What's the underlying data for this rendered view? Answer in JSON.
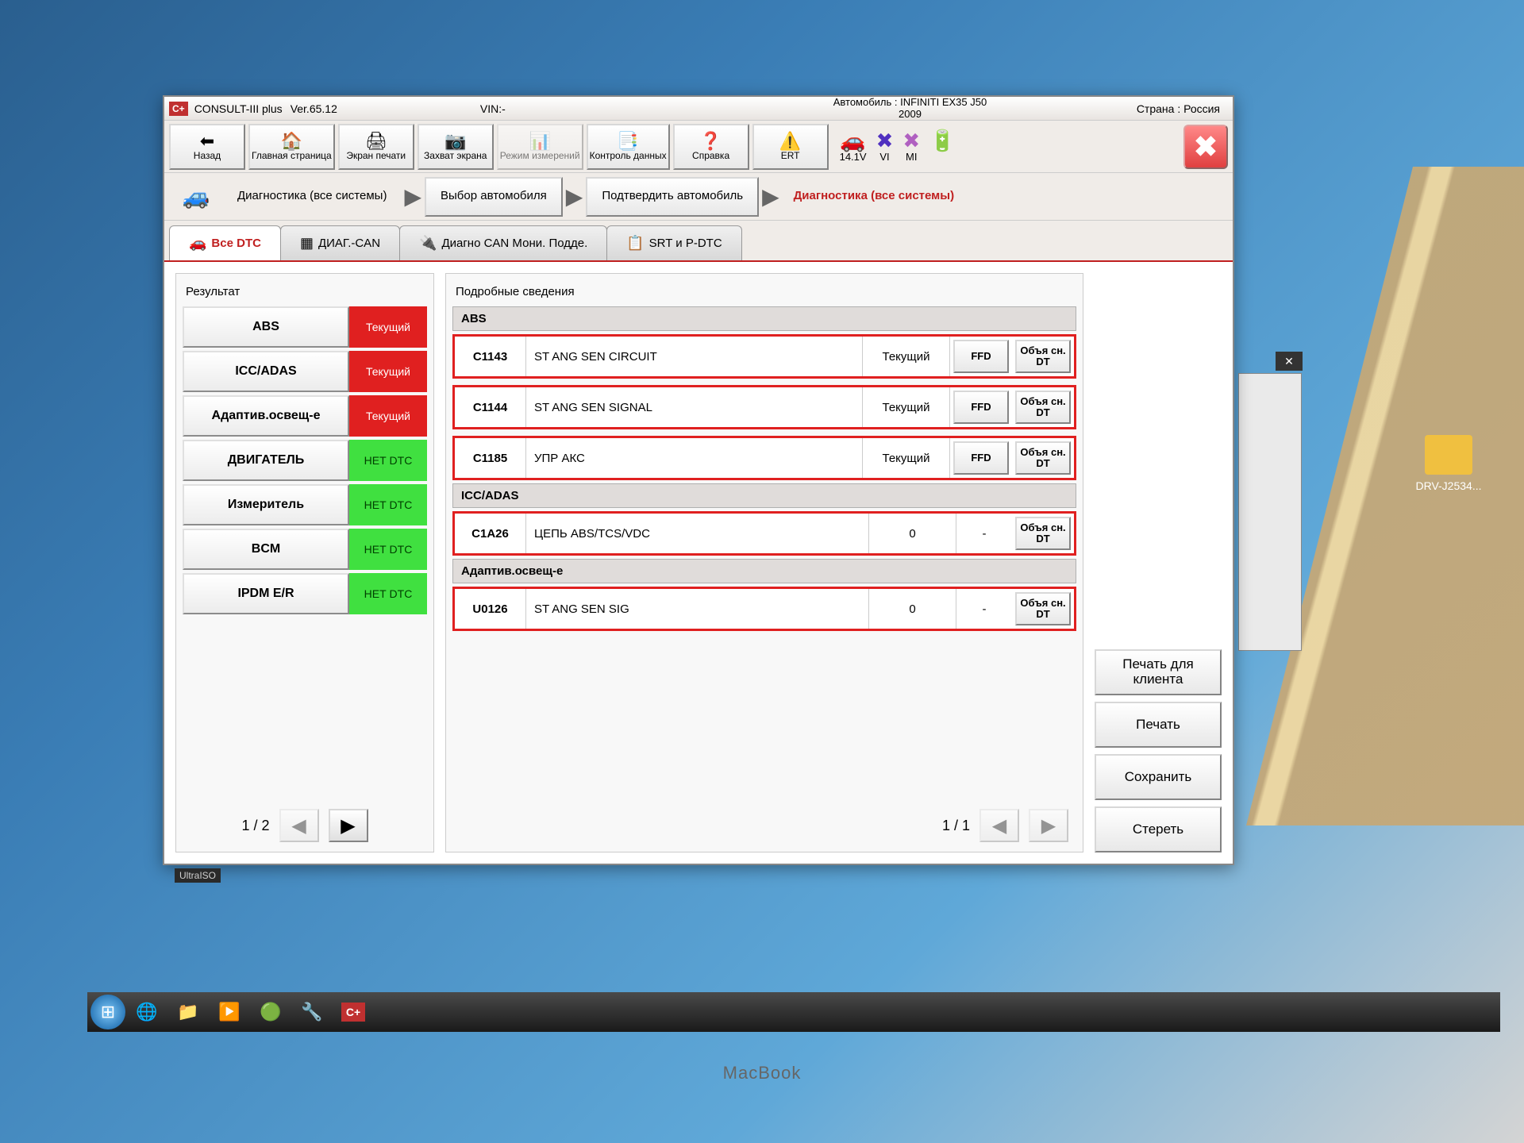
{
  "header": {
    "app_badge": "C+",
    "app_name": "CONSULT-III plus",
    "version_label": "Ver.65.12",
    "vin_label": "VIN:-",
    "vehicle_label": "Автомобиль : INFINITI EX35 J50",
    "vehicle_year": "2009",
    "country_label": "Страна : Россия"
  },
  "toolbar": {
    "back": "Назад",
    "home": "Главная страница",
    "print_screen": "Экран печати",
    "capture": "Захват экрана",
    "mode": "Режим измерений",
    "rec_data": "Контроль данных",
    "help": "Справка",
    "ert": "ERT"
  },
  "status": {
    "voltage": "14.1V",
    "vi": "VI",
    "mi": "MI"
  },
  "breadcrumb": {
    "step1": "Диагностика (все системы)",
    "step2": "Выбор автомобиля",
    "step3": "Подтвердить автомобиль",
    "step4": "Диагностика (все системы)"
  },
  "tabs": {
    "all_dtc": "Все DTC",
    "diag_can": "ДИАГ.-CAN",
    "diag_can_mon": "Диагно CAN Мони. Подде.",
    "srt_pdtc": "SRT и P-DTC"
  },
  "left_panel": {
    "title": "Результат",
    "items": [
      {
        "name": "ABS",
        "status": "Текущий",
        "cls": "st-current"
      },
      {
        "name": "ICC/ADAS",
        "status": "Текущий",
        "cls": "st-current"
      },
      {
        "name": "Адаптив.освещ-е",
        "status": "Текущий",
        "cls": "st-current"
      },
      {
        "name": "ДВИГАТЕЛЬ",
        "status": "НЕТ DTC",
        "cls": "st-none"
      },
      {
        "name": "Измеритель",
        "status": "НЕТ DTC",
        "cls": "st-none"
      },
      {
        "name": "BCM",
        "status": "НЕТ DTC",
        "cls": "st-none"
      },
      {
        "name": "IPDM E/R",
        "status": "НЕТ DTC",
        "cls": "st-none"
      }
    ],
    "page_label": "1 / 2"
  },
  "detail": {
    "title": "Подробные сведения",
    "groups": [
      {
        "name": "ABS",
        "dtcs": [
          {
            "code": "C1143",
            "desc": "ST ANG SEN CIRCUIT",
            "status": "Текущий",
            "btn1": "FFD",
            "btn2": "Объя сн. DT"
          },
          {
            "code": "C1144",
            "desc": "ST ANG SEN SIGNAL",
            "status": "Текущий",
            "btn1": "FFD",
            "btn2": "Объя сн. DT"
          },
          {
            "code": "C1185",
            "desc": "УПР АКС",
            "status": "Текущий",
            "btn1": "FFD",
            "btn2": "Объя сн. DT"
          }
        ]
      },
      {
        "name": "ICC/ADAS",
        "dtcs": [
          {
            "code": "C1A26",
            "desc": "ЦЕПЬ ABS/TCS/VDC",
            "status": "0",
            "btn1": "-",
            "btn2": "Объя сн. DT"
          }
        ]
      },
      {
        "name": "Адаптив.освещ-е",
        "dtcs": [
          {
            "code": "U0126",
            "desc": "ST ANG SEN SIG",
            "status": "0",
            "btn1": "-",
            "btn2": "Объя сн. DT"
          }
        ]
      }
    ],
    "page_label": "1 / 1"
  },
  "actions": {
    "print_client": "Печать для клиента",
    "print": "Печать",
    "save": "Сохранить",
    "erase": "Стереть"
  },
  "desktop": {
    "folder_label": "DRV-J2534..."
  },
  "misc": {
    "ultra": "UltraISO",
    "macbook": "MacBook"
  }
}
